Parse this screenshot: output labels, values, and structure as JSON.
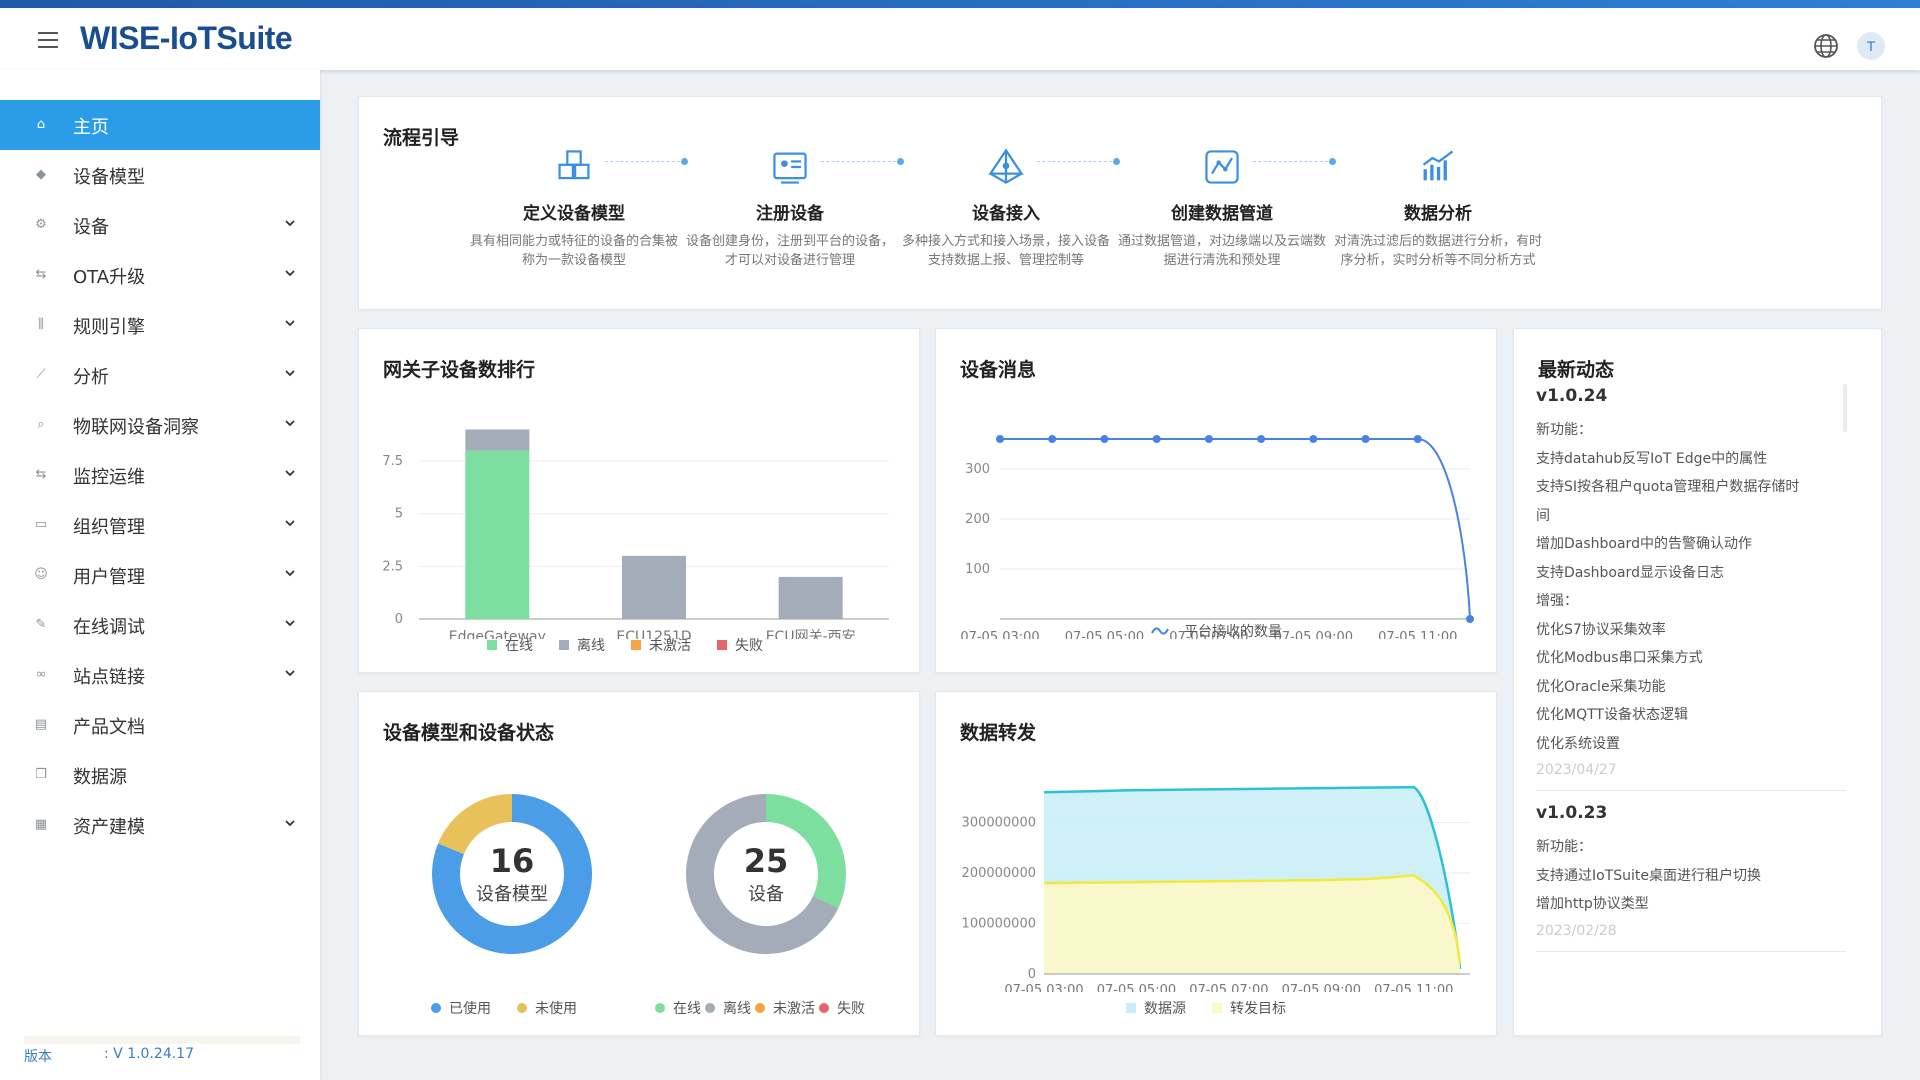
{
  "app": {
    "brand": "WISE-IoTSuite",
    "avatar_letter": "T",
    "version_label": "版本",
    "version_value": ": V 1.0.24.17"
  },
  "sidebar": {
    "items": [
      {
        "label": "主页",
        "icon": "home-icon",
        "active": true,
        "expandable": false
      },
      {
        "label": "设备模型",
        "icon": "cube-icon",
        "expandable": false
      },
      {
        "label": "设备",
        "icon": "device-icon",
        "expandable": true
      },
      {
        "label": "OTA升级",
        "icon": "ota-icon",
        "expandable": true
      },
      {
        "label": "规则引擎",
        "icon": "rules-icon",
        "expandable": true
      },
      {
        "label": "分析",
        "icon": "chart-icon",
        "expandable": true
      },
      {
        "label": "物联网设备洞察",
        "icon": "search-icon",
        "expandable": true
      },
      {
        "label": "监控运维",
        "icon": "monitor-icon",
        "expandable": true
      },
      {
        "label": "组织管理",
        "icon": "org-icon",
        "expandable": true
      },
      {
        "label": "用户管理",
        "icon": "user-icon",
        "expandable": true
      },
      {
        "label": "在线调试",
        "icon": "debug-icon",
        "expandable": true
      },
      {
        "label": "站点链接",
        "icon": "link-icon",
        "expandable": true
      },
      {
        "label": "产品文档",
        "icon": "doc-icon",
        "expandable": false
      },
      {
        "label": "数据源",
        "icon": "datasource-icon",
        "expandable": false
      },
      {
        "label": "资产建模",
        "icon": "grid-icon",
        "expandable": true
      }
    ]
  },
  "flow": {
    "title": "流程引导",
    "steps": [
      {
        "title": "定义设备模型",
        "desc": "具有相同能力或特征的设备的合集被称为一款设备模型",
        "icon": "cubes-icon"
      },
      {
        "title": "注册设备",
        "desc": "设备创建身份，注册到平台的设备，才可以对设备进行管理",
        "icon": "register-icon"
      },
      {
        "title": "设备接入",
        "desc": "多种接入方式和接入场景，接入设备支持数据上报、管理控制等",
        "icon": "access-icon"
      },
      {
        "title": "创建数据管道",
        "desc": "通过数据管道，对边缘端以及云端数据进行清洗和预处理",
        "icon": "pipeline-icon"
      },
      {
        "title": "数据分析",
        "desc": "对清洗过滤后的数据进行分析，有时序分析，实时分析等不同分析方式",
        "icon": "analysis-icon"
      }
    ]
  },
  "cards": {
    "gateway": {
      "title": "网关子设备数排行"
    },
    "messages": {
      "title": "设备消息"
    },
    "model_status": {
      "title": "设备模型和设备状态"
    },
    "forward": {
      "title": "数据转发"
    },
    "news": {
      "title": "最新动态"
    }
  },
  "colors": {
    "online": "#7ddf9f",
    "offline": "#a3acb8",
    "inactive": "#f4a444",
    "failed": "#e9646a",
    "used": "#4a9de6",
    "unused": "#e8c15a",
    "accent": "#2b9de8"
  },
  "chart_data": [
    {
      "type": "bar",
      "id": "gateway",
      "title": "网关子设备数排行",
      "categories": [
        "EdgeGateway",
        "ECU1251D",
        "ECU网关-西安"
      ],
      "series": [
        {
          "name": "在线",
          "values": [
            8,
            0,
            0
          ]
        },
        {
          "name": "离线",
          "values": [
            1,
            3,
            2
          ]
        },
        {
          "name": "未激活",
          "values": [
            0,
            0,
            0
          ]
        },
        {
          "name": "失败",
          "values": [
            0,
            0,
            0
          ]
        }
      ],
      "yticks": [
        "0",
        "2.5",
        "5",
        "7.5"
      ],
      "ylim": [
        0,
        9.5
      ],
      "stacked": true,
      "legend": "bottom"
    },
    {
      "type": "line",
      "id": "messages",
      "title": "设备消息",
      "x": [
        "07-05 03:00",
        "07-05 04:00",
        "07-05 05:00",
        "07-05 06:00",
        "07-05 07:00",
        "07-05 08:00",
        "07-05 09:00",
        "07-05 10:00",
        "07-05 11:00",
        "07-05 12:00"
      ],
      "xticks": [
        "07-05 03:00",
        "07-05 05:00",
        "07-05 07:00",
        "07-05 09:00",
        "07-05 11:00"
      ],
      "series": [
        {
          "name": "平台接收的数量",
          "values": [
            360,
            360,
            360,
            360,
            360,
            360,
            360,
            360,
            360,
            0
          ]
        }
      ],
      "yticks": [
        "100",
        "200",
        "300"
      ],
      "ylim": [
        0,
        400
      ],
      "legend": "bottom"
    },
    {
      "type": "pie",
      "id": "model_donut",
      "center_value": "16",
      "center_label": "设备模型",
      "slices": [
        {
          "name": "已使用",
          "value": 13
        },
        {
          "name": "未使用",
          "value": 3
        }
      ]
    },
    {
      "type": "pie",
      "id": "device_donut",
      "center_value": "25",
      "center_label": "设备",
      "slices": [
        {
          "name": "在线",
          "value": 8
        },
        {
          "name": "离线",
          "value": 17
        },
        {
          "name": "未激活",
          "value": 0
        },
        {
          "name": "失败",
          "value": 0
        }
      ]
    },
    {
      "type": "area",
      "id": "forward",
      "title": "数据转发",
      "x": [
        "07-05 03:00",
        "07-05 04:00",
        "07-05 05:00",
        "07-05 06:00",
        "07-05 07:00",
        "07-05 08:00",
        "07-05 09:00",
        "07-05 10:00",
        "07-05 11:00",
        "07-05 12:00"
      ],
      "xticks": [
        "07-05 03:00",
        "07-05 05:00",
        "07-05 07:00",
        "07-05 09:00",
        "07-05 11:00"
      ],
      "series": [
        {
          "name": "数据源",
          "values": [
            360000000,
            362000000,
            364000000,
            365000000,
            366000000,
            367000000,
            368000000,
            369000000,
            370000000,
            10000000
          ]
        },
        {
          "name": "转发目标",
          "values": [
            180000000,
            181000000,
            182000000,
            183000000,
            184000000,
            185000000,
            186000000,
            188000000,
            195000000,
            20000000
          ]
        }
      ],
      "yticks": [
        "0",
        "100000000",
        "200000000",
        "300000000"
      ],
      "ylim": [
        0,
        400000000
      ],
      "legend": "bottom"
    }
  ],
  "legends": {
    "gateway": [
      "在线",
      "离线",
      "未激活",
      "失败"
    ],
    "messages": "平台接收的数量",
    "model": [
      "已使用",
      "未使用"
    ],
    "device": [
      "在线",
      "离线",
      "未激活",
      "失败"
    ],
    "forward": [
      "数据源",
      "转发目标"
    ]
  },
  "news": [
    {
      "version": "v1.0.24",
      "lines": [
        "新功能：",
        "支持datahub反写IoT Edge中的属性",
        "支持SI按各租户quota管理租户数据存储时",
        "间",
        "增加Dashboard中的告警确认动作",
        "支持Dashboard显示设备日志",
        "增强：",
        "优化S7协议采集效率",
        "优化Modbus串口采集方式",
        "优化Oracle采集功能",
        "优化MQTT设备状态逻辑",
        "优化系统设置"
      ],
      "date": "2023/04/27"
    },
    {
      "version": "v1.0.23",
      "lines": [
        "新功能：",
        "支持通过IoTSuite桌面进行租户切换",
        "增加http协议类型"
      ],
      "date": "2023/02/28"
    }
  ]
}
